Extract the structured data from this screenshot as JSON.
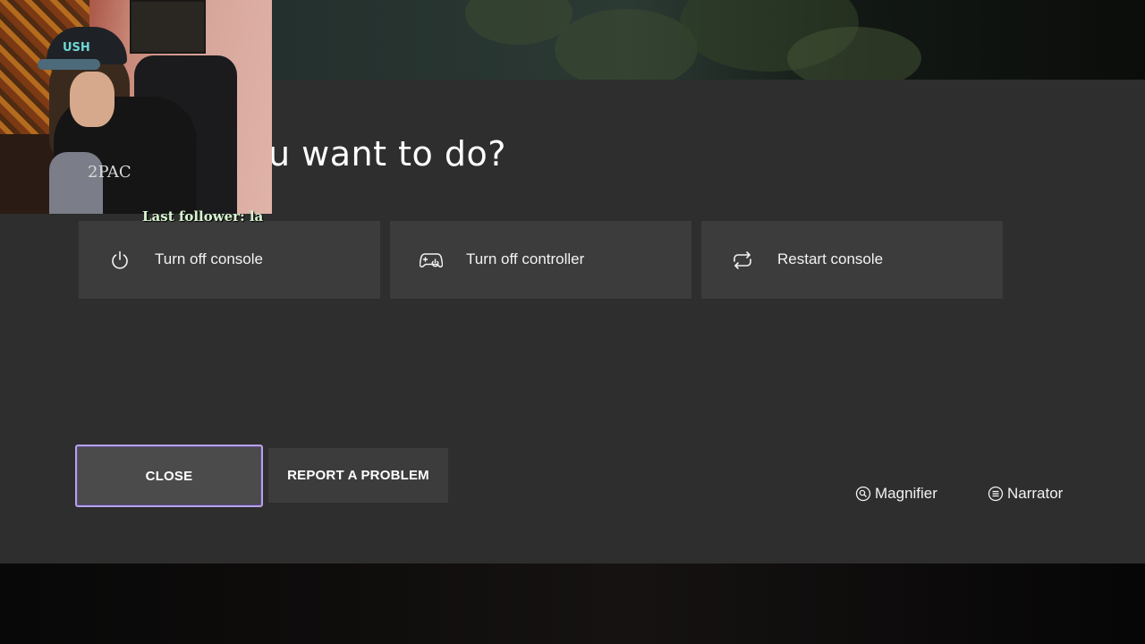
{
  "dialog": {
    "title": "u want to do?",
    "options": [
      {
        "label": "Turn off console",
        "icon": "power-icon"
      },
      {
        "label": "Turn off controller",
        "icon": "controller-icon"
      },
      {
        "label": "Restart console",
        "icon": "restart-icon"
      }
    ],
    "buttons": {
      "close_label": "CLOSE",
      "report_label": "REPORT A PROBLEM"
    },
    "accessibility": {
      "magnifier_label": "Magnifier",
      "magnifier_icon": "magnifier-icon",
      "narrator_label": "Narrator",
      "narrator_icon": "narrator-icon"
    }
  },
  "overlay": {
    "follower_text": "Last follower: la",
    "cap_text": "USH",
    "shirt_text": "2PAC"
  },
  "colors": {
    "panel_bg": "#2d2e2d",
    "tile_bg": "#3b3c3b",
    "focus_border": "#b7a2e6"
  }
}
